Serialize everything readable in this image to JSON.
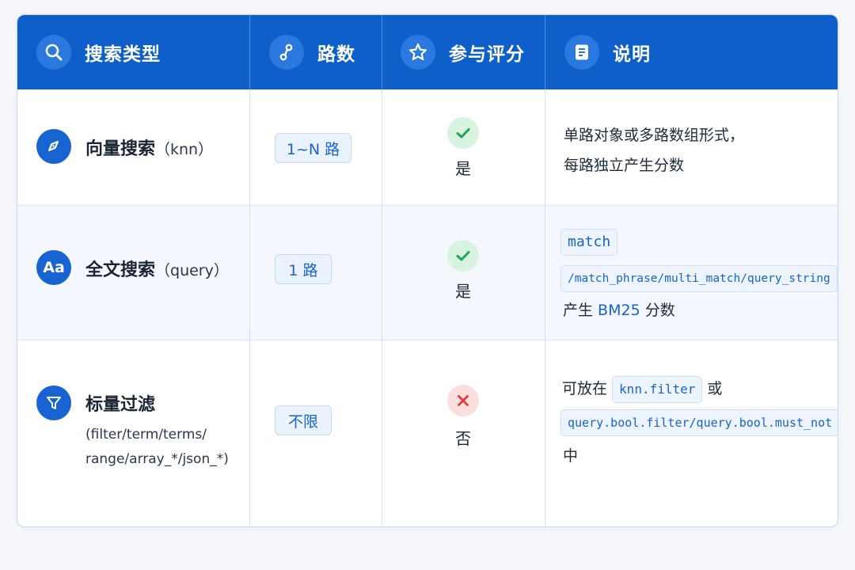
{
  "header": {
    "col1": {
      "label": "搜索类型",
      "icon": "search-icon"
    },
    "col2": {
      "label": "路数",
      "icon": "route-icon"
    },
    "col3": {
      "label": "参与评分",
      "icon": "star-icon"
    },
    "col4": {
      "label": "说明",
      "icon": "document-icon"
    }
  },
  "rows": [
    {
      "icon": "compass-icon",
      "name": "向量搜索",
      "name_suffix": "（knn）",
      "paths": "1~N 路",
      "scored": "是",
      "scored_icon": "check-icon",
      "desc_line1": "单路对象或多路数组形式，",
      "desc_line2": "每路独立产生分数"
    },
    {
      "icon": "font-icon",
      "icon_text": "Aa",
      "name": "全文搜索",
      "name_suffix": "（query）",
      "paths": "1 路",
      "scored": "是",
      "scored_icon": "check-icon",
      "code1": "match",
      "code2": "/match_phrase/multi_match/query_string",
      "desc_prefix": "产生 ",
      "desc_highlight": "BM25",
      "desc_suffix": " 分数"
    },
    {
      "icon": "filter-icon",
      "name": "标量过滤",
      "name_detail_line1": "(filter/term/terms/",
      "name_detail_line2": "range/array_*/json_*)",
      "paths": "不限",
      "scored": "否",
      "scored_icon": "x-icon",
      "desc_prefix": "可放在 ",
      "code1": "knn.filter",
      "desc_mid": " 或",
      "code2": "query.bool.filter/query.bool.must_not",
      "desc_end": "中"
    }
  ],
  "colors": {
    "header_bg": "#0f5fcb",
    "accent": "#1663d1",
    "yes_green": "#22a455",
    "no_red": "#e0393e"
  }
}
